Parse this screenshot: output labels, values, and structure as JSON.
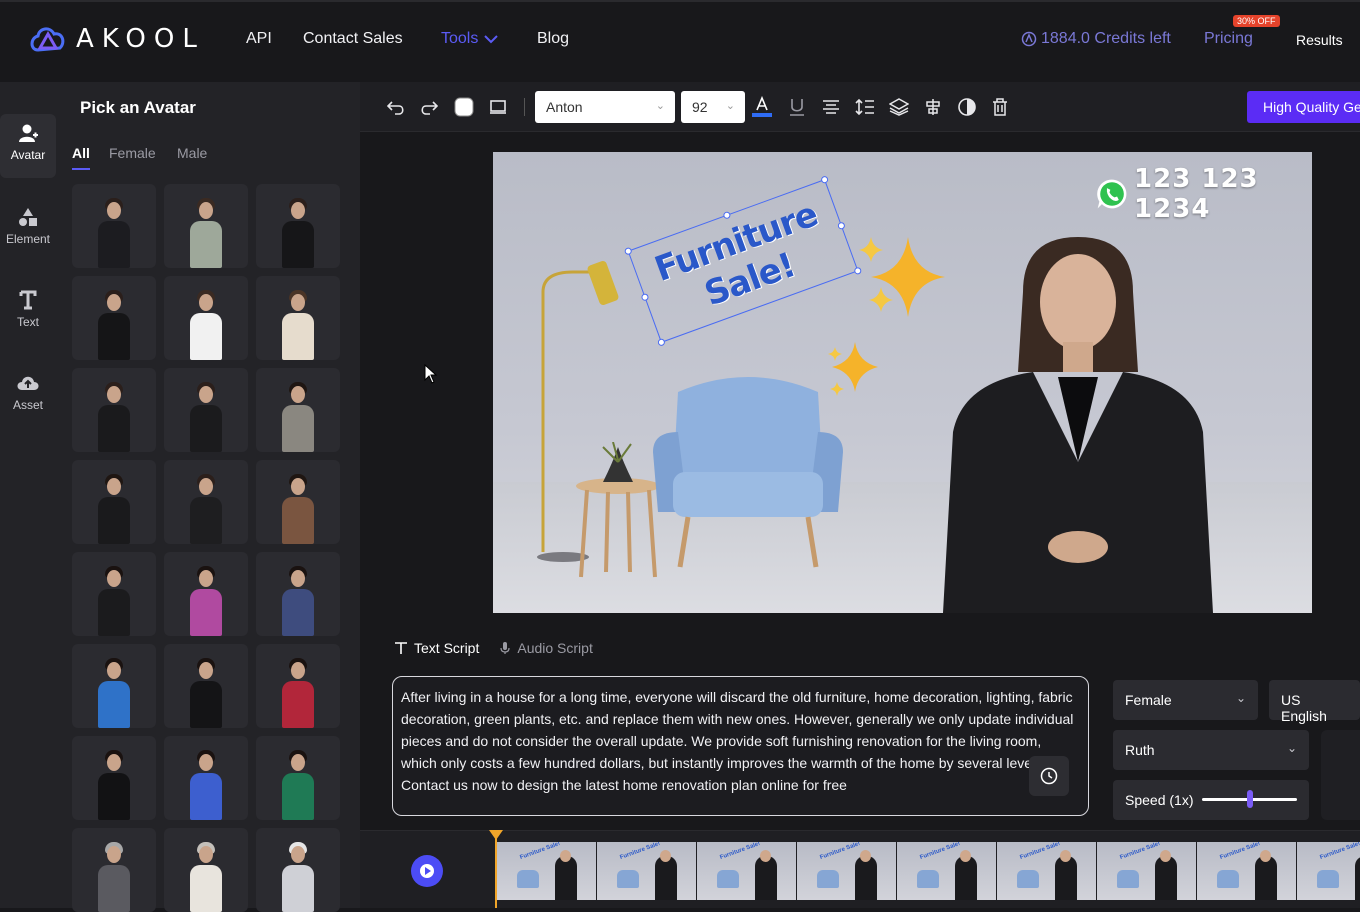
{
  "brand": {
    "name": "AKOOL"
  },
  "nav": {
    "api": "API",
    "contact": "Contact Sales",
    "tools": "Tools",
    "blog": "Blog",
    "credits": "1884.0 Credits left",
    "pricing": "Pricing",
    "pricing_badge": "30% OFF",
    "results": "Results"
  },
  "rail": {
    "avatar": "Avatar",
    "element": "Element",
    "text": "Text",
    "asset": "Asset"
  },
  "panel": {
    "title": "Pick an Avatar",
    "tabs": [
      "All",
      "Female",
      "Male"
    ]
  },
  "avatars": [
    {
      "body": "#1c1c20",
      "hair": "#2b1f1b"
    },
    {
      "body": "#9ea89a",
      "hair": "#3a2a22"
    },
    {
      "body": "#161618",
      "hair": "#2b1f1b"
    },
    {
      "body": "#151517",
      "hair": "#2b1f1b"
    },
    {
      "body": "#f1f1f1",
      "hair": "#3a2a22"
    },
    {
      "body": "#e6dccd",
      "hair": "#4a3426"
    },
    {
      "body": "#1a1a1c",
      "hair": "#2b1f1b"
    },
    {
      "body": "#1b1b1d",
      "hair": "#2b1f1b"
    },
    {
      "body": "#8a8780",
      "hair": "#1f1612"
    },
    {
      "body": "#1a1a1c",
      "hair": "#1f1612"
    },
    {
      "body": "#1e1e20",
      "hair": "#2b1f1b"
    },
    {
      "body": "#7a5540",
      "hair": "#1f1612"
    },
    {
      "body": "#1b1b1d",
      "hair": "#1a1210"
    },
    {
      "body": "#b04aa0",
      "hair": "#1a1210"
    },
    {
      "body": "#3e4c7e",
      "hair": "#1a1210"
    },
    {
      "body": "#2f72c8",
      "hair": "#1a1210"
    },
    {
      "body": "#141416",
      "hair": "#1a1210"
    },
    {
      "body": "#b2263a",
      "hair": "#1a1210"
    },
    {
      "body": "#121214",
      "hair": "#1a1210"
    },
    {
      "body": "#3d5fcf",
      "hair": "#1a1210"
    },
    {
      "body": "#1f7a55",
      "hair": "#1a1210"
    },
    {
      "body": "#5a5a60",
      "hair": "#a8a8a8"
    },
    {
      "body": "#e8e4dd",
      "hair": "#c4c0ba"
    },
    {
      "body": "#cfd0d6",
      "hair": "#e6e6e6"
    }
  ],
  "toolbar": {
    "font": "Anton",
    "size": "92",
    "high_quality": "High Quality Ge"
  },
  "canvas": {
    "phone_number": "123 123 1234",
    "headline_line1": "Furniture",
    "headline_line2": "Sale!"
  },
  "script": {
    "text_tab": "Text Script",
    "audio_tab": "Audio Script",
    "body": "After living in a house for a long time, everyone will discard the old furniture, home decoration, lighting, fabric decoration, green plants, etc. and replace them with new ones. However, generally we only update individual pieces and do not consider the overall update. We provide soft furnishing renovation for the living room, which only costs a few hundred dollars, but instantly improves the warmth of the home by several levels! Contact us now to design the latest home renovation plan online for free"
  },
  "voice": {
    "gender": "Female",
    "language": "US English",
    "voice_name": "Ruth",
    "speed_label": "Speed (1x)",
    "speed_value": 0.5
  },
  "timeline": {
    "frame_label": "Furniture Sale!",
    "frame_count": 9
  },
  "colors": {
    "accent": "#5b5bf5",
    "button": "#5b2cf5",
    "badge": "#e5432b",
    "playhead": "#f0a52a"
  }
}
